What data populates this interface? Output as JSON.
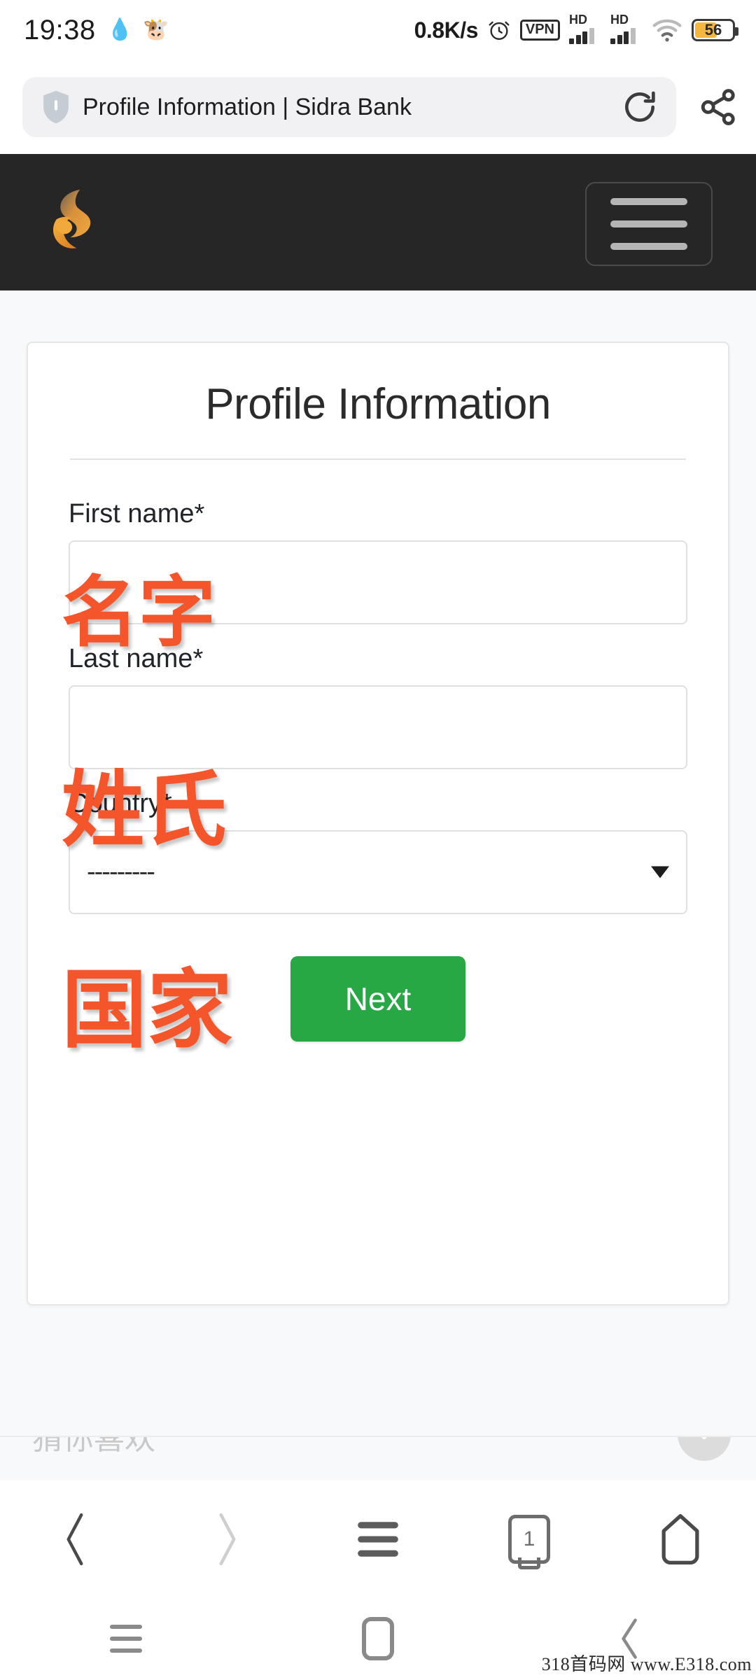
{
  "status_bar": {
    "time": "19:38",
    "emoji_icons": [
      "droplet-app-icon",
      "cow-app-icon"
    ],
    "network_speed": "0.8K/s",
    "alarm_icon": "alarm-clock-icon",
    "vpn_label": "VPN",
    "sim1": {
      "label": "HD",
      "bars": 3,
      "total_bars": 4
    },
    "sim2": {
      "label": "HD",
      "bars": 3,
      "total_bars": 4
    },
    "wifi_icon": "wifi-icon",
    "battery_percent": "56"
  },
  "browser_bar": {
    "security_icon": "shield-icon",
    "page_title": "Profile Information | Sidra Bank",
    "reload_icon": "reload-icon",
    "share_icon": "share-icon"
  },
  "site_nav": {
    "logo_name": "sidra-bank-logo",
    "menu_label": "hamburger-menu"
  },
  "form_card": {
    "title": "Profile Information",
    "fields": [
      {
        "label": "First name*",
        "value": "",
        "placeholder": "",
        "type": "text",
        "annotation": "名字"
      },
      {
        "label": "Last name*",
        "value": "",
        "placeholder": "",
        "type": "text",
        "annotation": "姓氏"
      },
      {
        "label": "Country*",
        "value": "---------",
        "placeholder": "---------",
        "type": "select",
        "annotation": "国家"
      }
    ],
    "submit_label": "Next",
    "submit_color": "#28a745"
  },
  "recommend_strip": {
    "title": "猜你喜欢",
    "close_icon": "chevron-down-close-icon"
  },
  "browser_toolbar": {
    "items": [
      {
        "name": "back",
        "icon": "chevron-left-icon",
        "enabled": true
      },
      {
        "name": "forward",
        "icon": "chevron-right-icon",
        "enabled": false
      },
      {
        "name": "menu",
        "icon": "hamburger-icon",
        "enabled": true
      },
      {
        "name": "tabs",
        "icon": "tab-count-icon",
        "count": "1",
        "enabled": true
      },
      {
        "name": "home",
        "icon": "home-pentagon-icon",
        "enabled": true
      }
    ]
  },
  "android_nav": {
    "items": [
      {
        "name": "recents",
        "icon": "recents-icon"
      },
      {
        "name": "home",
        "icon": "home-square-icon"
      },
      {
        "name": "back",
        "icon": "back-chevron-icon"
      }
    ]
  },
  "watermark": {
    "text": "318首码网  www.E318.com"
  },
  "colors": {
    "navbar_bg": "#262626",
    "accent_orange": "#E8912B",
    "annotation_red": "#F4552B",
    "primary_green": "#28a745",
    "page_bg": "#f8f9fa",
    "battery_amber": "#F5B73D"
  }
}
